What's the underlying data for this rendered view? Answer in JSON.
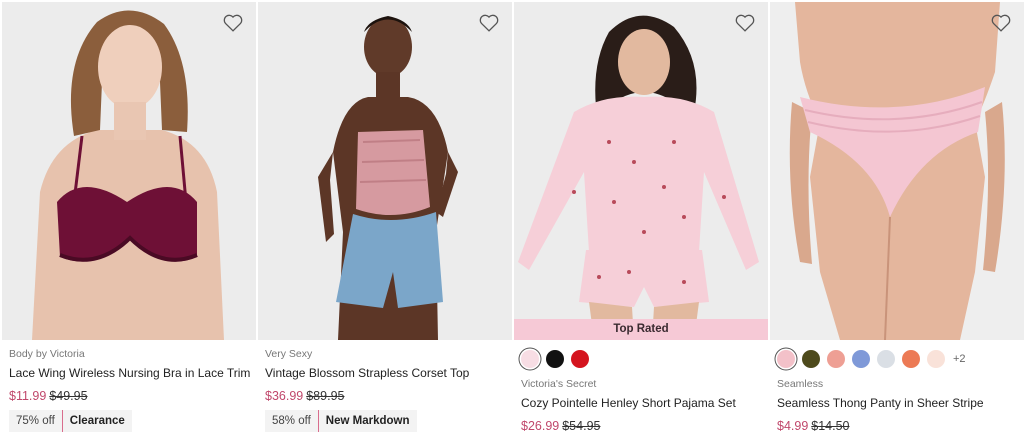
{
  "products": [
    {
      "brand": "Body by Victoria",
      "name": "Lace Wing Wireless Nursing Bra in Lace Trim",
      "sale_price": "$11.99",
      "original_price": "$49.95",
      "discount": "75% off",
      "tag": "Clearance",
      "wishlist_icon": "heart-outline-icon"
    },
    {
      "brand": "Very Sexy",
      "name": "Vintage Blossom Strapless Corset Top",
      "sale_price": "$36.99",
      "original_price": "$89.95",
      "discount": "58% off",
      "tag": "New Markdown",
      "wishlist_icon": "heart-outline-icon"
    },
    {
      "badge": "Top Rated",
      "brand": "Victoria's Secret",
      "name": "Cozy Pointelle Henley Short Pajama Set",
      "sale_price": "$26.99",
      "original_price": "$54.95",
      "swatches": [
        "#f7dde4",
        "#111111",
        "#d4141e"
      ],
      "wishlist_icon": "heart-outline-icon"
    },
    {
      "brand": "Seamless",
      "name": "Seamless Thong Panty in Sheer Stripe",
      "sale_price": "$4.99",
      "original_price": "$14.50",
      "swatches": [
        "#f3c1c9",
        "#4d4a1c",
        "#ee9f94",
        "#7f99d8",
        "#dadfe5",
        "#ec7a55",
        "#f9e2d9"
      ],
      "more_swatches": "+2",
      "wishlist_icon": "heart-outline-icon"
    }
  ],
  "colors": {
    "sale": "#c0476b",
    "badge_bg": "#f6c9d6"
  }
}
